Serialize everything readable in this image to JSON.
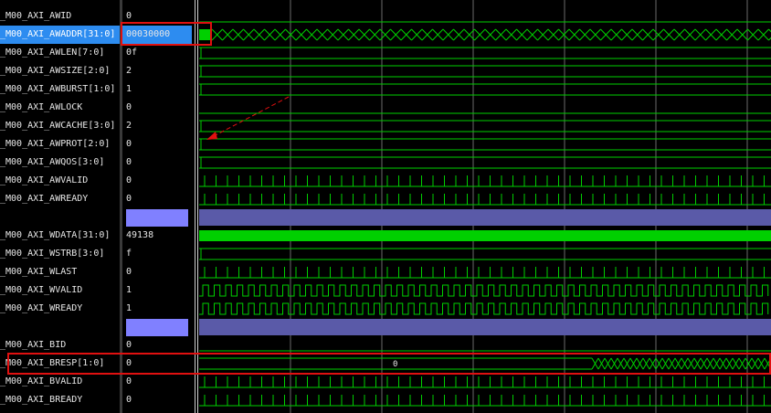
{
  "signals": [
    {
      "name": "_M00_AXI_AWID",
      "value": "0",
      "kind": "low"
    },
    {
      "name": "_M00_AXI_AWADDR[31:0]",
      "value": "00030000",
      "kind": "bus-toggle",
      "selected": true
    },
    {
      "name": "_M00_AXI_AWLEN[7:0]",
      "value": "0f",
      "kind": "bus-const"
    },
    {
      "name": "_M00_AXI_AWSIZE[2:0]",
      "value": "2",
      "kind": "bus-const"
    },
    {
      "name": "_M00_AXI_AWBURST[1:0]",
      "value": "1",
      "kind": "bus-const"
    },
    {
      "name": "_M00_AXI_AWLOCK",
      "value": "0",
      "kind": "low"
    },
    {
      "name": "_M00_AXI_AWCACHE[3:0]",
      "value": "2",
      "kind": "bus-const"
    },
    {
      "name": "_M00_AXI_AWPROT[2:0]",
      "value": "0",
      "kind": "bus-const"
    },
    {
      "name": "_M00_AXI_AWQOS[3:0]",
      "value": "0",
      "kind": "bus-const"
    },
    {
      "name": "_M00_AXI_AWVALID",
      "value": "0",
      "kind": "pulse-sparse"
    },
    {
      "name": "_M00_AXI_AWREADY",
      "value": "0",
      "kind": "pulse-sparse"
    },
    {
      "name": "",
      "value": "",
      "kind": "divider"
    },
    {
      "name": "_M00_AXI_WDATA[31:0]",
      "value": "49138",
      "kind": "bus-dense"
    },
    {
      "name": "_M00_AXI_WSTRB[3:0]",
      "value": "f",
      "kind": "bus-const"
    },
    {
      "name": "_M00_AXI_WLAST",
      "value": "0",
      "kind": "pulse-sparse"
    },
    {
      "name": "_M00_AXI_WVALID",
      "value": "1",
      "kind": "clock"
    },
    {
      "name": "_M00_AXI_WREADY",
      "value": "1",
      "kind": "clock"
    },
    {
      "name": "",
      "value": "",
      "kind": "divider"
    },
    {
      "name": "_M00_AXI_BID",
      "value": "0",
      "kind": "low"
    },
    {
      "name": "_M00_AXI_BRESP[1:0]",
      "value": "0",
      "kind": "bus-bresp",
      "bus_label": "0"
    },
    {
      "name": "_M00_AXI_BVALID",
      "value": "0",
      "kind": "pulse-sparse"
    },
    {
      "name": "_M00_AXI_BREADY",
      "value": "0",
      "kind": "pulse-sparse"
    }
  ],
  "colors": {
    "wave_green": "#00d000",
    "grid": "#6a6a6a",
    "divider": "#5a5aa8",
    "divider_value": "#8080ff",
    "selection": "#2d8cf0",
    "marker": "#e01010"
  }
}
